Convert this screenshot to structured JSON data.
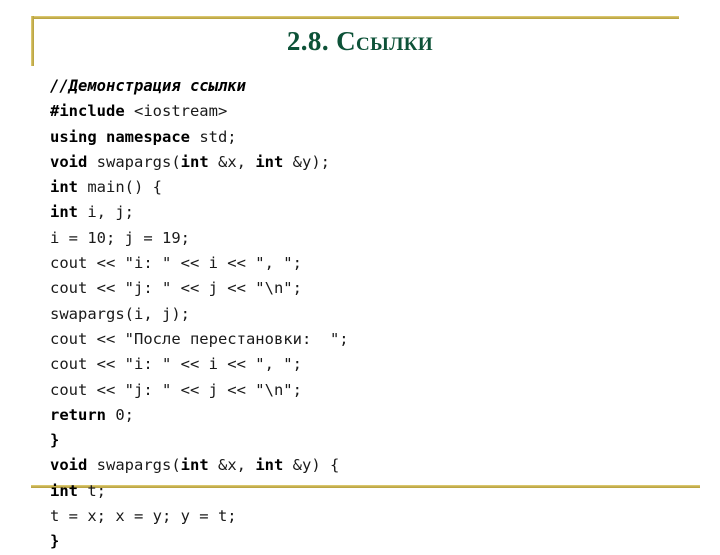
{
  "slide": {
    "title": "2.8. Ссылки",
    "title_color": "#0d5238",
    "frame_color": "#c2ab4b",
    "background_color": "#ffffff"
  },
  "code": {
    "language": "cpp",
    "text_color": "#1a1a1a",
    "lines": [
      {
        "id": "line-1",
        "style": "comment",
        "segments": [
          {
            "text": "//Демонстрация ссылки",
            "bold": true,
            "italic": true
          }
        ]
      },
      {
        "id": "line-2",
        "style": "code",
        "segments": [
          {
            "text": "#include",
            "bold": true
          },
          {
            "text": " <iostream>",
            "bold": false
          }
        ]
      },
      {
        "id": "line-3",
        "style": "code",
        "segments": [
          {
            "text": "using namespace",
            "bold": true
          },
          {
            "text": " std;",
            "bold": false
          }
        ]
      },
      {
        "id": "line-4",
        "style": "code",
        "segments": [
          {
            "text": "void",
            "bold": true
          },
          {
            "text": " swapargs(",
            "bold": false
          },
          {
            "text": "int",
            "bold": true
          },
          {
            "text": " &x, ",
            "bold": false
          },
          {
            "text": "int",
            "bold": true
          },
          {
            "text": " &y);",
            "bold": false
          }
        ]
      },
      {
        "id": "line-5",
        "style": "code",
        "segments": [
          {
            "text": "int",
            "bold": true
          },
          {
            "text": " main() {",
            "bold": false
          }
        ]
      },
      {
        "id": "line-6",
        "style": "code",
        "segments": [
          {
            "text": "int",
            "bold": true
          },
          {
            "text": " i, j;",
            "bold": false
          }
        ]
      },
      {
        "id": "line-7",
        "style": "code",
        "segments": [
          {
            "text": "i = 10; j = 19;",
            "bold": false
          }
        ]
      },
      {
        "id": "line-8",
        "style": "code",
        "segments": [
          {
            "text": "cout << \"i: \" << i << \", \";",
            "bold": false
          }
        ]
      },
      {
        "id": "line-9",
        "style": "code",
        "segments": [
          {
            "text": "cout << \"j: \" << j << \"\\n\";",
            "bold": false
          }
        ]
      },
      {
        "id": "line-10",
        "style": "code",
        "segments": [
          {
            "text": "swapargs(i, j);",
            "bold": false
          }
        ]
      },
      {
        "id": "line-11",
        "style": "code",
        "segments": [
          {
            "text": "cout << \"После перестановки:  \";",
            "bold": false
          }
        ]
      },
      {
        "id": "line-12",
        "style": "code",
        "segments": [
          {
            "text": "cout << \"i: \" << i << \", \";",
            "bold": false
          }
        ]
      },
      {
        "id": "line-13",
        "style": "code",
        "segments": [
          {
            "text": "cout << \"j: \" << j << \"\\n\";",
            "bold": false
          }
        ]
      },
      {
        "id": "line-14",
        "style": "code",
        "segments": [
          {
            "text": "return",
            "bold": true
          },
          {
            "text": " 0;",
            "bold": false
          }
        ]
      },
      {
        "id": "line-15",
        "style": "code",
        "segments": [
          {
            "text": "}",
            "bold": true
          }
        ]
      },
      {
        "id": "line-16",
        "style": "code",
        "segments": [
          {
            "text": "void",
            "bold": true
          },
          {
            "text": " swapargs(",
            "bold": false
          },
          {
            "text": "int",
            "bold": true
          },
          {
            "text": " &x, ",
            "bold": false
          },
          {
            "text": "int",
            "bold": true
          },
          {
            "text": " &y) {",
            "bold": false
          }
        ]
      },
      {
        "id": "line-17",
        "style": "code",
        "segments": [
          {
            "text": "int",
            "bold": true
          },
          {
            "text": " t;",
            "bold": false
          }
        ]
      },
      {
        "id": "line-18",
        "style": "code",
        "segments": [
          {
            "text": "t = x; x = y; y = t;",
            "bold": false
          }
        ]
      },
      {
        "id": "line-19",
        "style": "code",
        "segments": [
          {
            "text": "}",
            "bold": true
          }
        ]
      }
    ]
  }
}
